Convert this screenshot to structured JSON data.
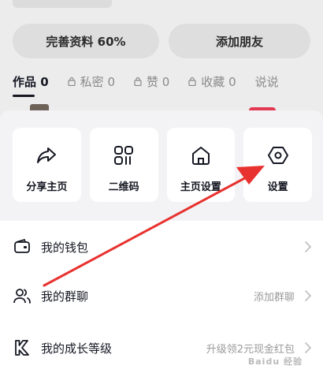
{
  "profile": {
    "top_chip": "",
    "complete_profile": "完善资料 60%",
    "add_friends": "添加朋友",
    "tabs": [
      {
        "label": "作品 0",
        "locked": false
      },
      {
        "label": "私密 0",
        "locked": true
      },
      {
        "label": "赞 0",
        "locked": true
      },
      {
        "label": "收藏 0",
        "locked": true
      },
      {
        "label": "说说",
        "locked": false
      }
    ]
  },
  "sheet": {
    "cards": [
      {
        "label": "分享主页",
        "icon": "share-arrow-icon"
      },
      {
        "label": "二维码",
        "icon": "qr-code-icon"
      },
      {
        "label": "主页设置",
        "icon": "home-icon"
      },
      {
        "label": "设置",
        "icon": "hexagon-settings-icon"
      }
    ],
    "rows": [
      {
        "label": "我的钱包",
        "hint": "",
        "icon": "wallet-icon"
      },
      {
        "label": "我的群聊",
        "hint": "添加群聊",
        "icon": "group-chat-icon"
      },
      {
        "label": "我的成长等级",
        "hint": "升级领2元现金红包",
        "icon": "growth-level-icon"
      }
    ]
  },
  "annotation": {
    "color": "#e8322f"
  },
  "watermark": "Baidu 经验"
}
